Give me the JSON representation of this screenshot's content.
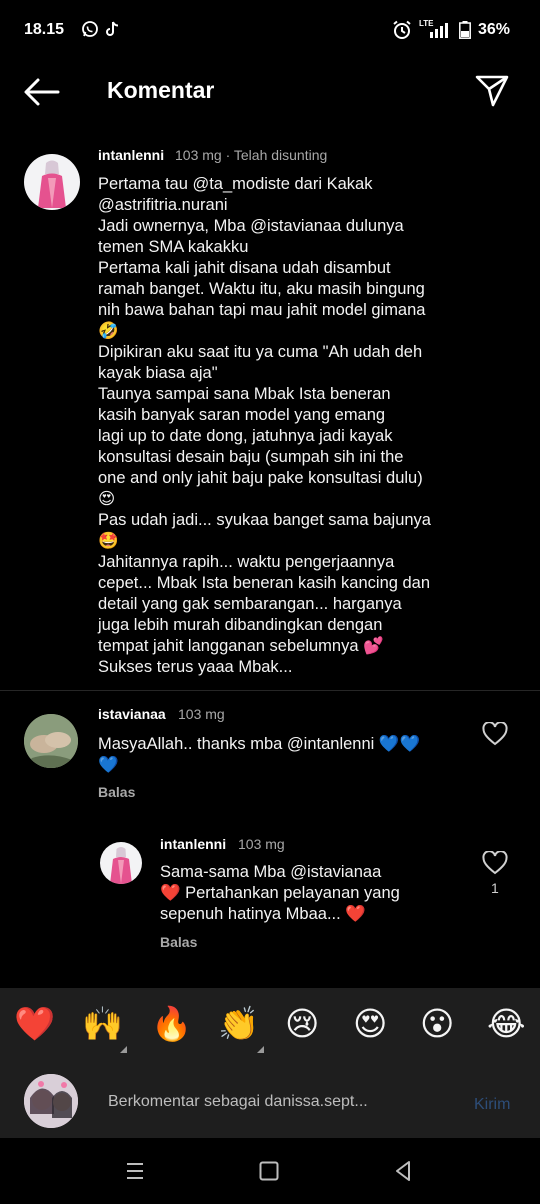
{
  "status_bar": {
    "time": "18.15",
    "battery": "36%",
    "network_label": "LTE",
    "icons": [
      "whatsapp-icon",
      "tiktok-icon",
      "alarm-icon",
      "signal-icon",
      "battery-icon"
    ]
  },
  "header": {
    "title": "Komentar",
    "back_icon": "arrow-left-icon",
    "share_icon": "paper-plane-icon"
  },
  "caption": {
    "username": "intanlenni",
    "meta": "103 mg · Telah disunting",
    "lines": [
      "Pertama tau @ta_modiste dari Kakak",
      "@astrifitria.nurani",
      "Jadi ownernya, Mba @istavianaa dulunya",
      "temen SMA kakakku",
      "Pertama kali jahit disana udah disambut",
      "ramah banget. Waktu itu, aku masih bingung",
      "nih bawa bahan tapi mau jahit model gimana",
      "🤣",
      "Dipikiran aku saat itu ya cuma \"Ah udah deh",
      "kayak biasa aja\"",
      "Taunya sampai sana Mbak Ista beneran",
      "kasih banyak saran model yang emang",
      "lagi up to date dong, jatuhnya jadi kayak",
      "konsultasi desain baju (sumpah sih ini the",
      "one and only jahit baju pake konsultasi dulu)",
      "😍",
      "Pas udah jadi... syukaa banget sama bajunya",
      "🤩",
      "Jahitannya rapih... waktu pengerjaannya",
      "cepet... Mbak Ista beneran kasih kancing dan",
      "detail yang gak sembarangan... harganya",
      "juga lebih murah dibandingkan dengan",
      "tempat jahit langganan sebelumnya 💕",
      "Sukses terus yaaa Mbak..."
    ]
  },
  "comments": [
    {
      "username": "istavianaa",
      "meta": "103 mg",
      "lines": [
        "MasyaAllah.. thanks mba @intanlenni 💙💙",
        "💙"
      ],
      "reply_label": "Balas",
      "likes": ""
    },
    {
      "username": "intanlenni",
      "meta": "103 mg",
      "lines": [
        "Sama-sama Mba @istavianaa",
        "❤️ Pertahankan pelayanan yang",
        "sepenuh hatinya Mbaa... ❤️"
      ],
      "reply_label": "Balas",
      "likes": "1"
    }
  ],
  "emoji_bar": [
    "❤️",
    "🙌",
    "🔥",
    "👏",
    "😢",
    "😍",
    "😮",
    "😂"
  ],
  "composer": {
    "placeholder": "Berkomentar sebagai danissa.sept...",
    "submit_label": "Kirim"
  },
  "nav": {
    "icons": [
      "recents-icon",
      "home-icon",
      "back-icon"
    ]
  },
  "colors": {
    "background": "#000000",
    "panel": "#1e1e1e",
    "muted_text": "#a8a8a8",
    "kirim_disabled": "#2d4d78",
    "heart_red": "#e0245e",
    "blue_heart": "#3b88e8"
  }
}
